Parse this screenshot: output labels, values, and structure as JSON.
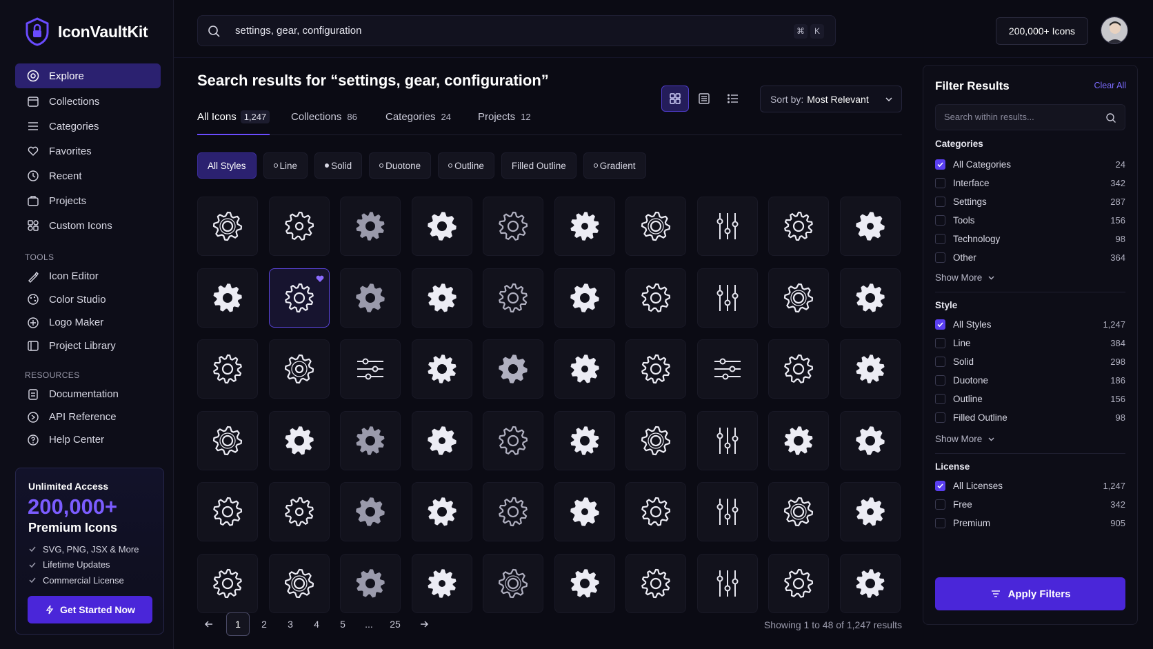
{
  "app": {
    "name": "IconVaultKit"
  },
  "nav": {
    "items": [
      {
        "label": "Explore",
        "icon": "compass-icon",
        "active": true
      },
      {
        "label": "Collections",
        "icon": "calendar-icon"
      },
      {
        "label": "Categories",
        "icon": "list-icon"
      },
      {
        "label": "Favorites",
        "icon": "heart-icon"
      },
      {
        "label": "Recent",
        "icon": "clock-icon"
      },
      {
        "label": "Projects",
        "icon": "briefcase-icon"
      },
      {
        "label": "Custom Icons",
        "icon": "custom-icon"
      }
    ],
    "tools_label": "TOOLS",
    "tools": [
      {
        "label": "Icon Editor",
        "icon": "brush-icon"
      },
      {
        "label": "Color Studio",
        "icon": "palette-icon"
      },
      {
        "label": "Logo Maker",
        "icon": "logo-icon"
      },
      {
        "label": "Project Library",
        "icon": "library-icon"
      }
    ],
    "resources_label": "RESOURCES",
    "resources": [
      {
        "label": "Documentation",
        "icon": "document-icon"
      },
      {
        "label": "API Reference",
        "icon": "api-icon"
      },
      {
        "label": "Help Center",
        "icon": "help-icon"
      }
    ]
  },
  "promo": {
    "title": "Unlimited Access",
    "big": "200,000+",
    "subtitle": "Premium Icons",
    "features": [
      "SVG, PNG, JSX & More",
      "Lifetime Updates",
      "Commercial License"
    ],
    "cta": "Get Started Now"
  },
  "search": {
    "value": "settings, gear, configuration",
    "shortcut_mod": "⌘",
    "shortcut_key": "K"
  },
  "header": {
    "count_label": "200,000+ Icons"
  },
  "results": {
    "title": "Search results for “settings, gear, configuration”",
    "sort_label": "Sort by:",
    "sort_value": "Most Relevant",
    "tabs": [
      {
        "label": "All Icons",
        "count": "1,247",
        "active": true
      },
      {
        "label": "Collections",
        "count": "86"
      },
      {
        "label": "Categories",
        "count": "24"
      },
      {
        "label": "Projects",
        "count": "12"
      }
    ],
    "styles": [
      "All Styles",
      "Line",
      "Solid",
      "Duotone",
      "Outline",
      "Filled Outline",
      "Gradient"
    ],
    "active_style": "All Styles",
    "selected_icon_index": 11,
    "pagination": {
      "prev": "previous-icon",
      "pages": [
        "1",
        "2",
        "3",
        "4",
        "5",
        "...",
        "25"
      ],
      "current": "1",
      "next": "next-icon"
    },
    "showing": "Showing 1 to 48 of 1,247 results"
  },
  "filters": {
    "title": "Filter Results",
    "clear": "Clear All",
    "search_placeholder": "Search within results...",
    "categories_label": "Categories",
    "categories": [
      {
        "label": "All Categories",
        "count": "24",
        "checked": true
      },
      {
        "label": "Interface",
        "count": "342"
      },
      {
        "label": "Settings",
        "count": "287"
      },
      {
        "label": "Tools",
        "count": "156"
      },
      {
        "label": "Technology",
        "count": "98"
      },
      {
        "label": "Other",
        "count": "364"
      }
    ],
    "show_more": "Show More",
    "style_label": "Style",
    "styles": [
      {
        "label": "All Styles",
        "count": "1,247",
        "checked": true
      },
      {
        "label": "Line",
        "count": "384"
      },
      {
        "label": "Solid",
        "count": "298"
      },
      {
        "label": "Duotone",
        "count": "186"
      },
      {
        "label": "Outline",
        "count": "156"
      },
      {
        "label": "Filled Outline",
        "count": "98"
      }
    ],
    "license_label": "License",
    "licenses": [
      {
        "label": "All Licenses",
        "count": "1,247",
        "checked": true
      },
      {
        "label": "Free",
        "count": "342"
      },
      {
        "label": "Premium",
        "count": "905"
      }
    ],
    "apply": "Apply Filters"
  },
  "colors": {
    "accent": "#4a26d9",
    "accent_light": "#7b5cff",
    "background": "#0b0b14"
  }
}
